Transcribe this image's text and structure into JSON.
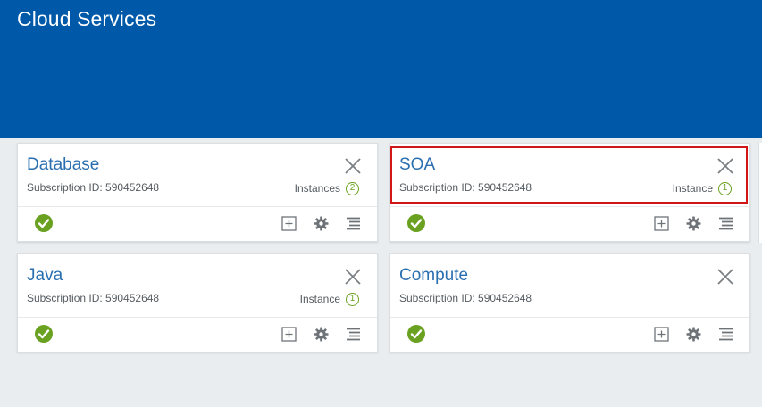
{
  "header": {
    "title": "Cloud Services"
  },
  "cards": [
    {
      "title": "Database",
      "subscription": "Subscription ID: 590452648",
      "instances_label": "Instances",
      "instances_count": "2"
    },
    {
      "title": "SOA",
      "subscription": "Subscription ID: 590452648",
      "instances_label": "Instance",
      "instances_count": "1"
    },
    {
      "title": "Java",
      "subscription": "Subscription ID: 590452648",
      "instances_label": "Instance",
      "instances_count": "1"
    },
    {
      "title": "Compute",
      "subscription": "Subscription ID: 590452648"
    }
  ],
  "icons": {
    "status": "check-circle-icon",
    "close": "close-icon",
    "add": "add-box-icon",
    "settings": "gear-icon",
    "menu": "list-menu-icon"
  },
  "colors": {
    "banner": "#0059a8",
    "title_link": "#2a6fb0",
    "status_green": "#6aa121",
    "highlight": "#d01616"
  }
}
